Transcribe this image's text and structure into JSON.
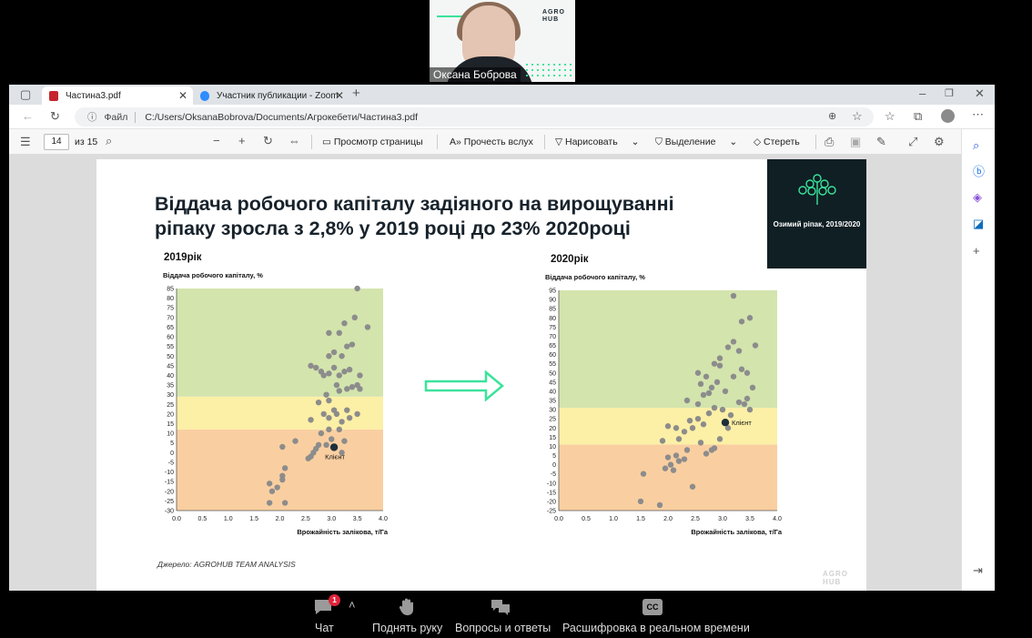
{
  "participant": {
    "name": "Оксана Боброва",
    "logo": "AGRO HUB"
  },
  "tabs": [
    {
      "title": "Частина3.pdf",
      "favicon": "pdf-icon"
    },
    {
      "title": "Участник публикации - Zoom",
      "favicon": "zoom-icon"
    }
  ],
  "address": {
    "label": "Файл",
    "url": "C:/Users/OksanaBobrova/Documents/Агрокебети/Частина3.pdf"
  },
  "pdf_toolbar": {
    "page": "14",
    "of": "из 15",
    "view": "Просмотр страницы",
    "read": "Прочесть вслух",
    "draw": "Нарисовать",
    "highlight": "Выделение",
    "erase": "Стереть"
  },
  "slide": {
    "title": "Віддача робочого капіталу задіяного на вирощуванні ріпаку зросла з 2,8% у 2019 році до 23% 2020році",
    "badge": "Озимий ріпак, 2019/2020",
    "source": "Джерело: AGROHUB TEAM ANALYSIS",
    "watermark": "AGRO HUB"
  },
  "chart_data": [
    {
      "type": "scatter",
      "title": "2019рік",
      "ylabel": "Віддача робочого капіталу, %",
      "xlabel": "Врожайність залікова, т/Га",
      "xlim": [
        0,
        4.0
      ],
      "ylim": [
        -30,
        85
      ],
      "xticks": [
        "0.0",
        "0.5",
        "1.0",
        "1.5",
        "2.0",
        "2.5",
        "3.0",
        "3.5",
        "4.0"
      ],
      "yticks": [
        "85",
        "80",
        "75",
        "70",
        "65",
        "60",
        "55",
        "50",
        "45",
        "40",
        "35",
        "30",
        "25",
        "20",
        "15",
        "10",
        "5",
        "0",
        "-5",
        "-10",
        "-15",
        "-20",
        "-25",
        "-30"
      ],
      "bands": [
        {
          "from": -30,
          "to": 12,
          "color": "#f9cfa1"
        },
        {
          "from": 12,
          "to": 29,
          "color": "#fcefa6"
        },
        {
          "from": 29,
          "to": 85,
          "color": "#d3e4ad"
        }
      ],
      "client": {
        "x": 3.05,
        "y": 2.8,
        "label": "Клієнт"
      },
      "points": [
        [
          1.8,
          -26
        ],
        [
          2.1,
          -26
        ],
        [
          1.8,
          -16
        ],
        [
          1.85,
          -20
        ],
        [
          1.95,
          -18
        ],
        [
          2.05,
          -12
        ],
        [
          2.1,
          -8
        ],
        [
          2.05,
          -14
        ],
        [
          2.05,
          3
        ],
        [
          2.3,
          6
        ],
        [
          2.55,
          -3
        ],
        [
          2.6,
          -2
        ],
        [
          2.65,
          0
        ],
        [
          2.7,
          2
        ],
        [
          2.75,
          4
        ],
        [
          2.8,
          10
        ],
        [
          2.9,
          4
        ],
        [
          2.95,
          12
        ],
        [
          3.0,
          7
        ],
        [
          3.15,
          12
        ],
        [
          3.2,
          0
        ],
        [
          3.25,
          6
        ],
        [
          2.6,
          17
        ],
        [
          2.85,
          20
        ],
        [
          2.95,
          18
        ],
        [
          3.05,
          22
        ],
        [
          3.1,
          20
        ],
        [
          3.2,
          16
        ],
        [
          3.3,
          22
        ],
        [
          3.35,
          18
        ],
        [
          3.5,
          20
        ],
        [
          2.75,
          26
        ],
        [
          2.9,
          30
        ],
        [
          2.95,
          27
        ],
        [
          3.1,
          35
        ],
        [
          3.15,
          32
        ],
        [
          3.3,
          33
        ],
        [
          3.4,
          34
        ],
        [
          3.5,
          35
        ],
        [
          3.55,
          33
        ],
        [
          2.6,
          45
        ],
        [
          2.7,
          44
        ],
        [
          2.8,
          42
        ],
        [
          2.85,
          40
        ],
        [
          2.95,
          41
        ],
        [
          3.05,
          44
        ],
        [
          3.15,
          40
        ],
        [
          3.25,
          42
        ],
        [
          3.35,
          43
        ],
        [
          3.55,
          40
        ],
        [
          2.95,
          50
        ],
        [
          3.05,
          52
        ],
        [
          3.2,
          50
        ],
        [
          3.3,
          55
        ],
        [
          3.15,
          62
        ],
        [
          2.95,
          62
        ],
        [
          3.4,
          56
        ],
        [
          3.25,
          67
        ],
        [
          3.45,
          70
        ],
        [
          3.7,
          65
        ],
        [
          3.5,
          85
        ]
      ]
    },
    {
      "type": "scatter",
      "title": "2020рік",
      "ylabel": "Віддача робочого капіталу, %",
      "xlabel": "Врожайність залікова, т/Га",
      "xlim": [
        0,
        4.0
      ],
      "ylim": [
        -25,
        95
      ],
      "xticks": [
        "0.0",
        "0.5",
        "1.0",
        "1.5",
        "2.0",
        "2.5",
        "3.0",
        "3.5",
        "4.0"
      ],
      "yticks": [
        "95",
        "90",
        "85",
        "80",
        "75",
        "70",
        "65",
        "60",
        "55",
        "50",
        "45",
        "40",
        "35",
        "30",
        "25",
        "20",
        "15",
        "10",
        "5",
        "0",
        "-5",
        "-10",
        "-15",
        "-20",
        "-25"
      ],
      "bands": [
        {
          "from": -25,
          "to": 11,
          "color": "#f9cfa1"
        },
        {
          "from": 11,
          "to": 31,
          "color": "#fcefa6"
        },
        {
          "from": 31,
          "to": 95,
          "color": "#d3e4ad"
        }
      ],
      "client": {
        "x": 3.05,
        "y": 23,
        "label": "Клієнт"
      },
      "points": [
        [
          1.5,
          -20
        ],
        [
          1.85,
          -22
        ],
        [
          1.55,
          -5
        ],
        [
          1.95,
          -2
        ],
        [
          2.05,
          0
        ],
        [
          2.1,
          -3
        ],
        [
          2.0,
          4
        ],
        [
          2.15,
          5
        ],
        [
          2.2,
          2
        ],
        [
          2.3,
          3
        ],
        [
          2.35,
          8
        ],
        [
          2.45,
          -12
        ],
        [
          2.45,
          20
        ],
        [
          2.6,
          12
        ],
        [
          2.7,
          6
        ],
        [
          2.8,
          8
        ],
        [
          2.85,
          9
        ],
        [
          2.95,
          14
        ],
        [
          3.1,
          20
        ],
        [
          1.9,
          13
        ],
        [
          2.0,
          21
        ],
        [
          2.15,
          20
        ],
        [
          2.2,
          14
        ],
        [
          2.3,
          18
        ],
        [
          2.4,
          24
        ],
        [
          2.55,
          25
        ],
        [
          2.65,
          22
        ],
        [
          2.75,
          28
        ],
        [
          2.85,
          31
        ],
        [
          3.0,
          30
        ],
        [
          3.15,
          27
        ],
        [
          3.3,
          34
        ],
        [
          3.4,
          33
        ],
        [
          3.5,
          30
        ],
        [
          2.35,
          35
        ],
        [
          2.55,
          33
        ],
        [
          2.65,
          38
        ],
        [
          2.75,
          39
        ],
        [
          2.8,
          42
        ],
        [
          2.9,
          45
        ],
        [
          3.05,
          40
        ],
        [
          3.2,
          48
        ],
        [
          3.35,
          52
        ],
        [
          3.45,
          50
        ],
        [
          3.55,
          42
        ],
        [
          2.6,
          44
        ],
        [
          2.7,
          48
        ],
        [
          2.85,
          55
        ],
        [
          2.95,
          54
        ],
        [
          3.1,
          64
        ],
        [
          3.2,
          67
        ],
        [
          3.3,
          62
        ],
        [
          3.35,
          78
        ],
        [
          3.5,
          80
        ],
        [
          3.6,
          65
        ],
        [
          2.55,
          50
        ],
        [
          2.95,
          58
        ],
        [
          3.2,
          92
        ],
        [
          3.45,
          36
        ]
      ]
    }
  ],
  "zoom_bar": {
    "chat": "Чат",
    "chat_badge": "1",
    "raise": "Поднять руку",
    "qa": "Вопросы и ответы",
    "cc": "Расшифровка в реальном времени"
  }
}
